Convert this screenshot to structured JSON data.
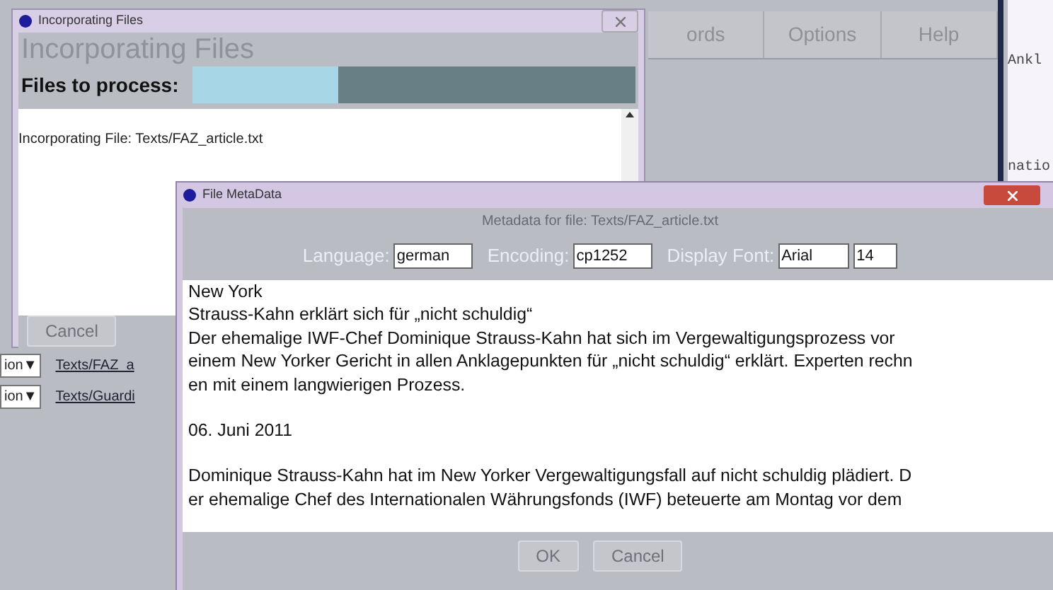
{
  "main_window": {
    "menu": [
      {
        "label": "ords"
      },
      {
        "label": "Options"
      },
      {
        "label": "Help"
      }
    ],
    "side_text": [
      "Ankl",
      "natio"
    ],
    "file_rows": [
      {
        "dropdown": "ion▼",
        "link": "Texts/FAZ_a"
      },
      {
        "dropdown": "ion▼",
        "link": "Texts/Guardi"
      }
    ]
  },
  "incorporating_window": {
    "title": "Incorporating Files",
    "heading": "Incorporating Files",
    "progress_label": "Files to process:",
    "level": 0.33,
    "log": [
      "Incorporating File: Texts/FAZ_article.txt"
    ],
    "cancel_button": {
      "label": "Cancel",
      "disabled": true
    }
  },
  "metadata_window": {
    "title": "File MetaData",
    "subtitle": "Metadata for file: Texts/FAZ_article.txt",
    "fields": [
      {
        "label": "Language:",
        "values": [
          "german"
        ]
      },
      {
        "label": "Encoding:",
        "values": [
          "cp1252"
        ]
      },
      {
        "label": "Display Font:",
        "values": [
          "Arial",
          "14"
        ]
      }
    ],
    "paragraphs": [
      [
        "New York",
        "Strauss-Kahn erklärt sich für „nicht schuldig“",
        "Der ehemalige IWF-Chef Dominique Strauss-Kahn hat sich im Vergewaltigungsprozess vor",
        "einem New Yorker Gericht in allen Anklagepunkten für „nicht schuldig“ erklärt. Experten rechn",
        "en mit einem langwierigen Prozess."
      ],
      [
        "06. Juni 2011"
      ],
      [
        "Dominique Strauss-Kahn hat im New Yorker Vergewaltigungsfall auf nicht schuldig plädiert. D",
        "er ehemalige Chef des Internationalen Währungsfonds (IWF) beteuerte am Montag vor dem"
      ]
    ],
    "buttons": [
      {
        "label": "OK",
        "disabled": true
      },
      {
        "label": "Cancel",
        "disabled": true
      }
    ]
  }
}
